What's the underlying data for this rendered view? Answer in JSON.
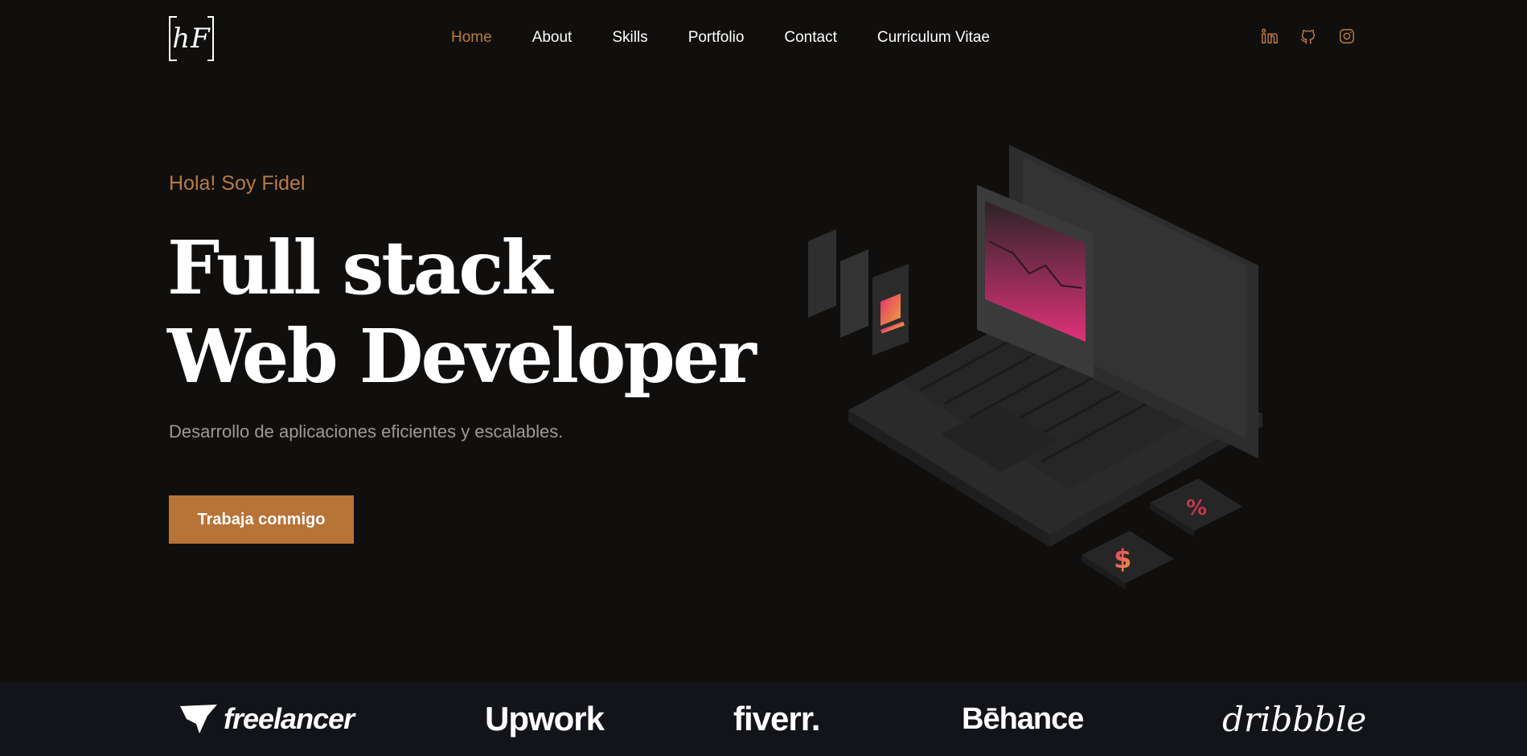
{
  "nav": {
    "logo": "hF",
    "items": [
      {
        "label": "Home",
        "active": true
      },
      {
        "label": "About"
      },
      {
        "label": "Skills"
      },
      {
        "label": "Portfolio"
      },
      {
        "label": "Contact"
      },
      {
        "label": "Curriculum Vitae"
      }
    ],
    "social": [
      "linkedin-icon",
      "github-icon",
      "instagram-icon"
    ]
  },
  "hero": {
    "greeting": "Hola! Soy Fidel",
    "title_line1": "Full stack",
    "title_line2": "Web Developer",
    "subtitle": "Desarrollo de aplicaciones eficientes y escalables.",
    "cta": "Trabaja conmigo",
    "art": "laptop-illustration"
  },
  "partners": [
    "freelancer",
    "Upwork",
    "fiverr.",
    "Bēhance",
    "dribbble"
  ],
  "colors": {
    "accent": "#b87b45",
    "button": "#b87337",
    "background": "#110f0d",
    "strip": "#121419"
  }
}
